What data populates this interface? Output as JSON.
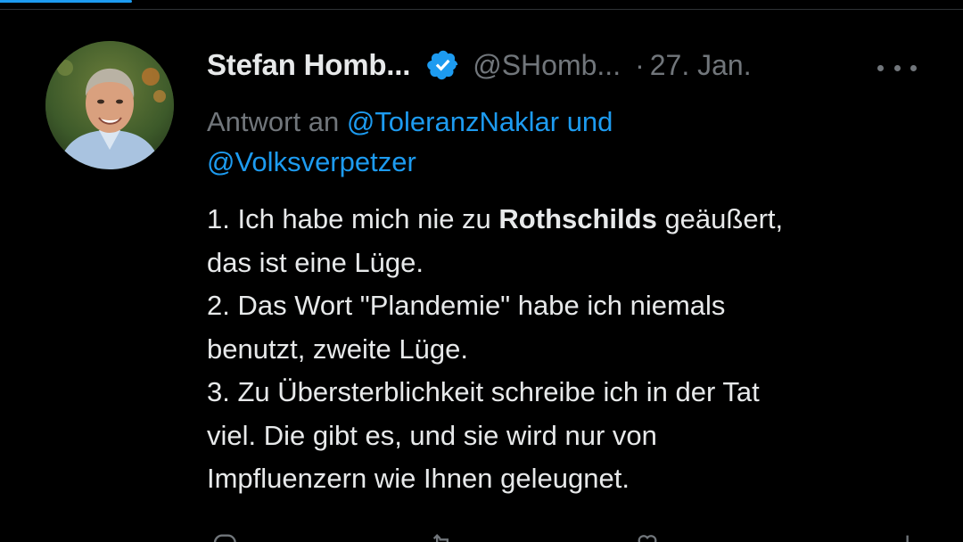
{
  "tweet": {
    "author": {
      "display_name": "Stefan Homb...",
      "handle": "@SHomb...",
      "verified": true
    },
    "separator": "·",
    "timestamp": "27. Jan.",
    "reply_to": {
      "prefix": "Antwort an",
      "mention_1": "@ToleranzNaklar",
      "joiner": "und",
      "mention_2": "@Volksverpetzer"
    },
    "body_lines": {
      "l1_pre": "1. Ich habe mich nie zu ",
      "l1_bold": "Rothschilds",
      "l1_post": " geäußert,",
      "l2": "das ist eine Lüge.",
      "l3": "2. Das Wort \"Plandemie\" habe ich niemals",
      "l4": "benutzt, zweite Lüge.",
      "l5": "3. Zu Übersterblichkeit schreibe ich in der Tat",
      "l6": "viel. Die gibt es, und sie wird nur von",
      "l7": "Impfluenzern wie Ihnen geleugnet."
    },
    "icons": {
      "verified": "verified-badge-icon",
      "more": "more-options-icon",
      "reply": "reply-icon",
      "retweet": "retweet-icon",
      "like": "like-icon",
      "views": "views-icon"
    }
  },
  "colors": {
    "background": "#000000",
    "text": "#e7e9ea",
    "secondary": "#71767b",
    "accent": "#1d9bf0"
  }
}
